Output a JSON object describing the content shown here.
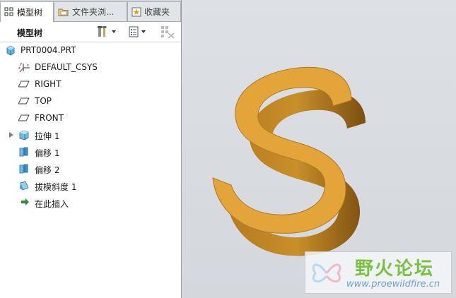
{
  "tabs": [
    {
      "label": "模型树",
      "icon": "model-tree-icon",
      "active": true
    },
    {
      "label": "文件夹浏...",
      "icon": "folder-browser-icon",
      "active": false
    },
    {
      "label": "收藏夹",
      "icon": "favorites-icon",
      "active": false
    }
  ],
  "toolbar": {
    "title": "模型树",
    "settings_icon": "tools-icon",
    "show_icon": "list-show-icon",
    "filter_icon": "tree-filter-icon"
  },
  "tree": {
    "root": {
      "label": "PRT0004.PRT",
      "icon": "part-icon"
    },
    "items": [
      {
        "label": "DEFAULT_CSYS",
        "icon": "coordinate-system-icon"
      },
      {
        "label": "RIGHT",
        "icon": "datum-plane-icon"
      },
      {
        "label": "TOP",
        "icon": "datum-plane-icon"
      },
      {
        "label": "FRONT",
        "icon": "datum-plane-icon"
      },
      {
        "label": "拉伸 1",
        "icon": "extrude-icon",
        "expandable": true
      },
      {
        "label": "偏移 1",
        "icon": "offset-icon"
      },
      {
        "label": "偏移 2",
        "icon": "offset-icon"
      },
      {
        "label": "拔模斜度 1",
        "icon": "draft-icon"
      },
      {
        "label": "在此插入",
        "icon": "insert-here-arrow-icon"
      }
    ]
  },
  "viewport": {
    "model_color": "#e3a43a",
    "background": "#d8dbdf"
  },
  "watermark": {
    "title": "野火论坛",
    "url": "www.proewildfire.cn"
  }
}
